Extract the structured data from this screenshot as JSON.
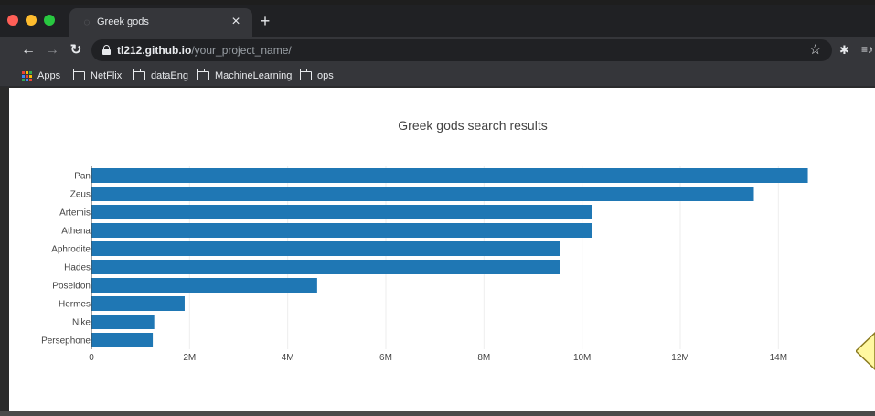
{
  "browser": {
    "tab_title": "Greek gods",
    "tab_close": "×",
    "new_tab": "+",
    "url_host": "tl212.github.io",
    "url_path": "/your_project_name/"
  },
  "icons": {
    "back": "arrow-left-icon",
    "forward": "arrow-right-icon",
    "reload": "reload-icon",
    "lock": "lock-icon",
    "star": "star-icon",
    "extensions": "puzzle-icon",
    "media": "media-queue-icon",
    "apps": "apps-grid-icon",
    "folder": "folder-icon"
  },
  "bookmarks": [
    "Apps",
    "NetFlix",
    "dataEng",
    "MachineLearning",
    "ops"
  ],
  "colors": {
    "bar": "#1f77b4",
    "tabstrip": "#202124",
    "toolbar": "#35363a"
  },
  "chart_data": {
    "type": "bar",
    "orientation": "horizontal",
    "title": "Greek gods search results",
    "xlabel": "",
    "ylabel": "",
    "categories": [
      "Pan",
      "Zeus",
      "Artemis",
      "Athena",
      "Aphrodite",
      "Hades",
      "Poseidon",
      "Hermes",
      "Nike",
      "Persephone"
    ],
    "values": [
      14600000,
      13500000,
      10200000,
      10200000,
      9550000,
      9550000,
      4600000,
      1900000,
      1280000,
      1250000
    ],
    "xlim": [
      0,
      15000000
    ],
    "xticks": [
      0,
      2000000,
      4000000,
      6000000,
      8000000,
      10000000,
      12000000,
      14000000
    ],
    "xtick_labels": [
      "0",
      "2M",
      "4M",
      "6M",
      "8M",
      "10M",
      "12M",
      "14M"
    ],
    "grid": "vertical"
  }
}
